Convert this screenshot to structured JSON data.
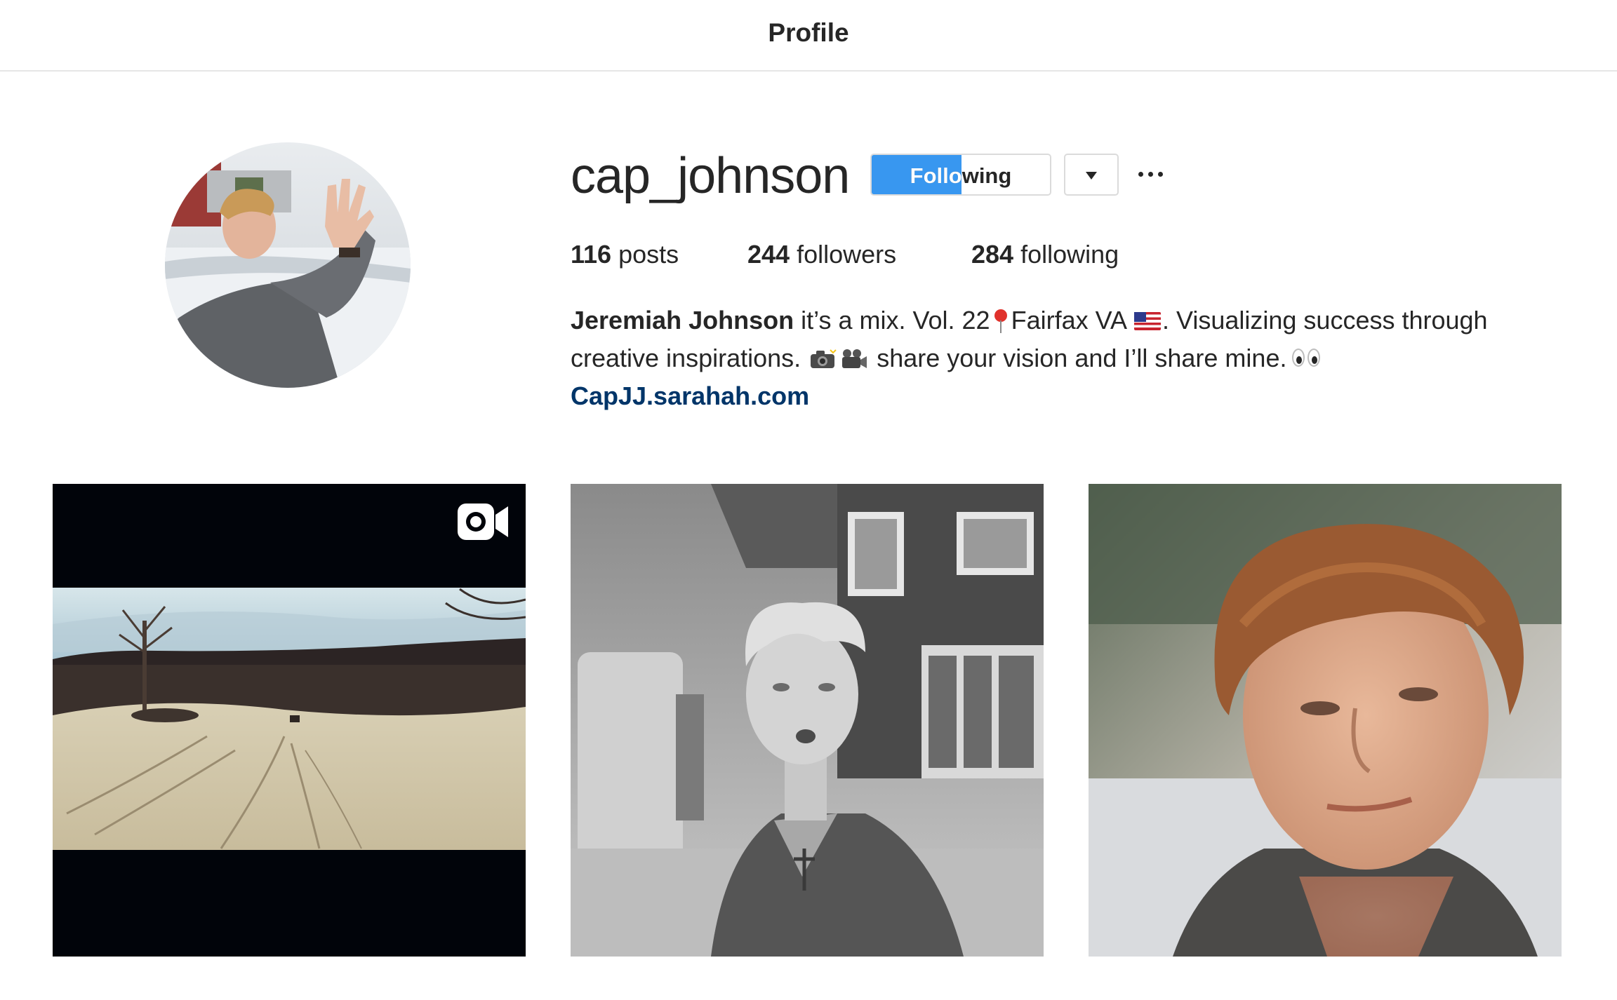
{
  "header": {
    "title": "Profile"
  },
  "profile": {
    "username": "cap_johnson",
    "follow_button_label": "Following",
    "follow_button_progress": 0.5,
    "stats": {
      "posts_count": "116",
      "posts_label": "posts",
      "followers_count": "244",
      "followers_label": "followers",
      "following_count": "284",
      "following_label": "following"
    },
    "bio": {
      "full_name": "Jeremiah Johnson",
      "line1_part1": "it’s a mix. Vol. 22",
      "line1_part2": "Fairfax VA",
      "line1_part3": ". Visualizing success through",
      "line2_part1": "creative inspirations.",
      "line2_part2": "share your vision and I’ll share mine.",
      "emoji_icons": [
        "round-pushpin-icon",
        "us-flag-icon",
        "camera-flash-icon",
        "movie-camera-icon",
        "eyes-icon"
      ],
      "link": "CapJJ.sarahah.com"
    }
  },
  "posts": [
    {
      "type": "video",
      "icon": "video-camera-icon",
      "description_icon": "snowy-field-photo"
    },
    {
      "type": "photo",
      "description_icon": "bw-portrait-photo"
    },
    {
      "type": "photo",
      "description_icon": "closeup-portrait-photo"
    }
  ],
  "colors": {
    "accent_blue": "#3897f0",
    "link_blue": "#003569",
    "text": "#262626",
    "border": "#dbdbdb"
  }
}
